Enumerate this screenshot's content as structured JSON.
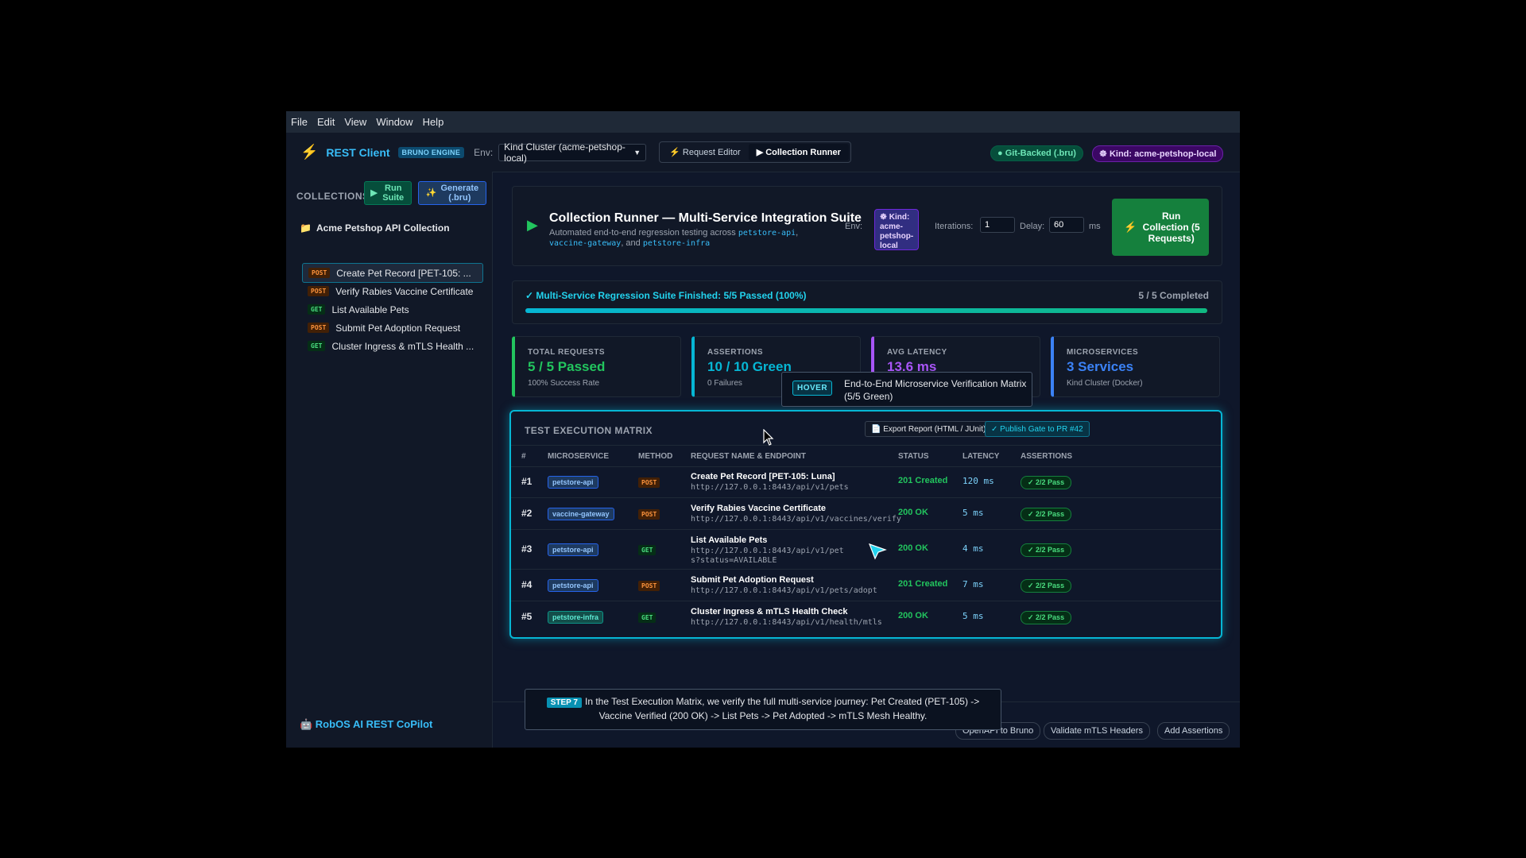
{
  "menu": [
    "File",
    "Edit",
    "View",
    "Window",
    "Help"
  ],
  "app": {
    "title": "REST Client",
    "engine_badge": "BRUNO ENGINE",
    "env_label": "Env:",
    "env_value": "Kind Cluster (acme-petshop-local)",
    "tab_request_editor": "⚡ Request Editor",
    "tab_collection_runner": "▶ Collection Runner",
    "git_badge": "● Git-Backed (.bru)",
    "kind_badge": "Kind: acme-petshop-local"
  },
  "sidebar": {
    "heading": "COLLECTIONS",
    "run_suite": "Run Suite",
    "generate": "Generate (.bru)",
    "collection_name": "Acme Petshop API Collection",
    "items": [
      {
        "method": "POST",
        "label": "Create Pet Record [PET-105: ..."
      },
      {
        "method": "POST",
        "label": "Verify Rabies Vaccine Certificate"
      },
      {
        "method": "GET",
        "label": "List Available Pets"
      },
      {
        "method": "POST",
        "label": "Submit Pet Adoption Request"
      },
      {
        "method": "GET",
        "label": "Cluster Ingress & mTLS Health ..."
      }
    ],
    "copilot": "🤖 RobOS AI REST CoPilot"
  },
  "runner": {
    "title": "Collection Runner — Multi-Service Integration Suite",
    "desc_prefix": "Automated end-to-end regression testing across ",
    "svc1": "petstore-api",
    "sep1": ",",
    "svc2": "vaccine-gateway",
    "sep2": ", and ",
    "svc3": "petstore-infra",
    "env_label": "Env:",
    "kind_env": "Kind: acme-petshop-local",
    "iterations_label": "Iterations:",
    "iterations_value": "1",
    "delay_label": "Delay:",
    "delay_value": "60",
    "delay_unit": "ms",
    "run_button": "Run Collection (5 Requests)"
  },
  "progress": {
    "text": "✓ Multi-Service Regression Suite Finished: 5/5 Passed (100%)",
    "count": "5 / 5 Completed",
    "fraction": 1.0
  },
  "stats": [
    {
      "label": "TOTAL REQUESTS",
      "value": "5 / 5 Passed",
      "sub": "100% Success Rate",
      "color": "#22c55e"
    },
    {
      "label": "ASSERTIONS",
      "value": "10 / 10 Green",
      "sub": "0 Failures",
      "color": "#06b6d4"
    },
    {
      "label": "AVG LATENCY",
      "value": "13.6 ms",
      "sub": "",
      "color": "#a855f7"
    },
    {
      "label": "MICROSERVICES",
      "value": "3 Services",
      "sub": "Kind Cluster (Docker)",
      "color": "#3b82f6"
    }
  ],
  "matrix": {
    "title": "TEST EXECUTION MATRIX",
    "export": "📄 Export Report (HTML / JUnit)",
    "publish": "✓ Publish Gate to PR #42",
    "headers": [
      "#",
      "MICROSERVICE",
      "METHOD",
      "REQUEST NAME & ENDPOINT",
      "STATUS",
      "LATENCY",
      "ASSERTIONS"
    ],
    "rows": [
      {
        "num": "#1",
        "service": "petstore-api",
        "method": "POST",
        "name": "Create Pet Record [PET-105: Luna]",
        "url": "http://127.0.0.1:8443/api/v1/pets",
        "status": "201 Created",
        "latency": "120 ms",
        "assertions": "✓ 2/2 Pass"
      },
      {
        "num": "#2",
        "service": "vaccine-gateway",
        "method": "POST",
        "name": "Verify Rabies Vaccine Certificate",
        "url": "http://127.0.0.1:8443/api/v1/vaccines/verify",
        "status": "200 OK",
        "latency": "5 ms",
        "assertions": "✓ 2/2 Pass"
      },
      {
        "num": "#3",
        "service": "petstore-api",
        "method": "GET",
        "name": "List Available Pets",
        "url": "http://127.0.0.1:8443/api/v1/pets?status=AVAILABLE",
        "status": "200 OK",
        "latency": "4 ms",
        "assertions": "✓ 2/2 Pass"
      },
      {
        "num": "#4",
        "service": "petstore-api",
        "method": "POST",
        "name": "Submit Pet Adoption Request",
        "url": "http://127.0.0.1:8443/api/v1/pets/adopt",
        "status": "201 Created",
        "latency": "7 ms",
        "assertions": "✓ 2/2 Pass"
      },
      {
        "num": "#5",
        "service": "petstore-infra",
        "method": "GET",
        "name": "Cluster Ingress & mTLS Health Check",
        "url": "http://127.0.0.1:8443/api/v1/health/mtls",
        "status": "200 OK",
        "latency": "5 ms",
        "assertions": "✓ 2/2 Pass"
      }
    ]
  },
  "hover_tip": {
    "tag": "HOVER",
    "text": "End-to-End Microservice Verification Matrix (5/5 Green)"
  },
  "step_tip": {
    "tag": "STEP 7",
    "text": "In the Test Execution Matrix, we verify the full multi-service journey: Pet Created (PET-105) -> Vaccine Verified (200 OK) -> List Pets -> Pet Adopted -> mTLS Mesh Healthy."
  },
  "footer_buttons": [
    "OpenAPI to Bruno",
    "Validate mTLS Headers",
    "Add Assertions"
  ]
}
